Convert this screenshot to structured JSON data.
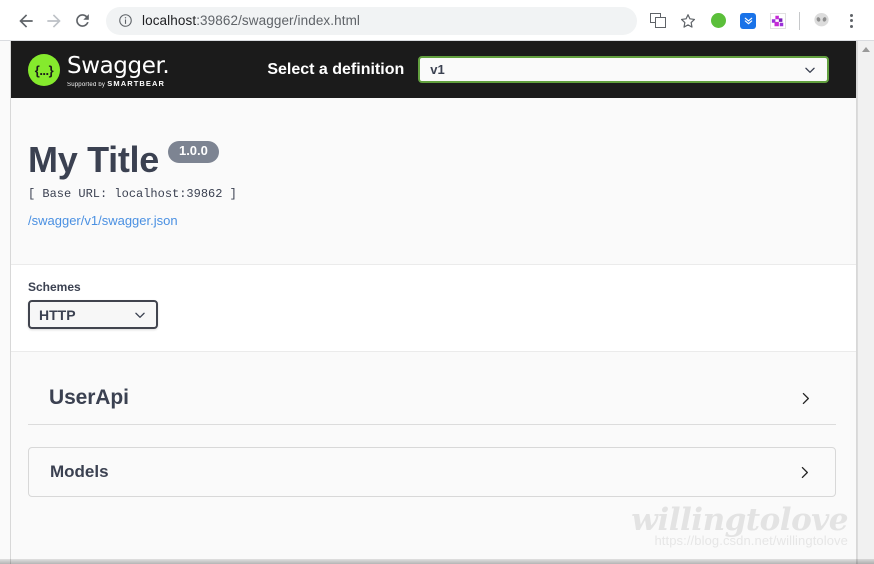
{
  "browser": {
    "back_icon": "arrow-left-icon",
    "forward_icon": "arrow-right-icon",
    "reload_icon": "reload-icon",
    "site_info_icon": "info-circle-icon",
    "url_host": "localhost",
    "url_rest": ":39862/swagger/index.html",
    "url_full": "localhost:39862/swagger/index.html",
    "extensions": [
      {
        "name": "translate-icon",
        "label": ""
      },
      {
        "name": "bookmark-star-icon",
        "label": ""
      },
      {
        "name": "green-circle-extension-icon",
        "label": ""
      },
      {
        "name": "blue-chevron-extension-icon",
        "label": ""
      },
      {
        "name": "purple-extension-icon",
        "label": ""
      },
      {
        "name": "profile-avatar-icon",
        "label": ""
      }
    ],
    "menu_icon": "three-dot-menu-icon"
  },
  "topbar": {
    "logo_word": "Swagger",
    "logo_dot": ".",
    "logo_mark_glyph": "{...}",
    "logo_supported_prefix": "Supported by",
    "logo_supported_brand": "SMARTBEAR",
    "definition_label": "Select a definition",
    "definition_value": "v1",
    "definition_options": [
      "v1"
    ],
    "chevron_icon": "chevron-down-icon"
  },
  "info": {
    "title": "My Title",
    "version": "1.0.0",
    "base_url": "[ Base URL: localhost:39862 ]",
    "spec_link": "/swagger/v1/swagger.json"
  },
  "schemes": {
    "label": "Schemes",
    "value": "HTTP",
    "options": [
      "HTTP"
    ],
    "chevron_icon": "chevron-down-icon"
  },
  "tags": [
    {
      "name": "UserApi",
      "expand_icon": "chevron-right-icon"
    }
  ],
  "models": {
    "name": "Models",
    "expand_icon": "chevron-right-icon"
  },
  "watermark": {
    "name": "willingtolove",
    "url": "https://blog.csdn.net/willingtolove"
  },
  "scrollbar": {
    "up_arrow_icon": "scroll-up-arrow-icon"
  },
  "colors": {
    "swagger_green": "#85ea2d",
    "topbar_dark": "#1b1b1b",
    "select_border_green": "#62a03f",
    "text_dark": "#3b4151",
    "link_blue": "#4a90e2",
    "version_badge_gray": "#7d8492"
  }
}
